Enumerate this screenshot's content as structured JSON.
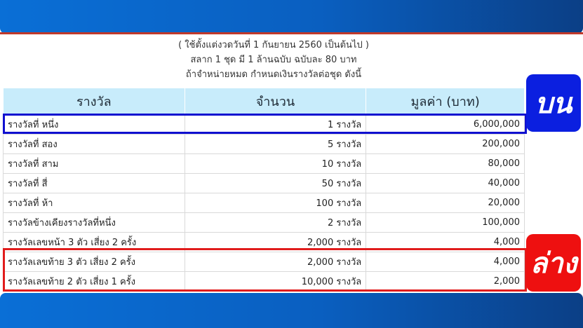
{
  "notes": [
    "( ใช้ตั้งแต่งวดวันที่ 1 กันยายน 2560 เป็นต้นไป )",
    "สลาก 1 ชุด มี 1 ล้านฉบับ ฉบับละ 80 บาท",
    "ถ้าจำหน่ายหมด กำหนดเงินรางวัลต่อชุด ดังนี้"
  ],
  "table": {
    "headers": [
      "รางวัล",
      "จำนวน",
      "มูลค่า (บาท)"
    ],
    "rows": [
      {
        "prize": "รางวัลที่ หนึ่ง",
        "count": "1 รางวัล",
        "value": "6,000,000"
      },
      {
        "prize": "รางวัลที่ สอง",
        "count": "5 รางวัล",
        "value": "200,000"
      },
      {
        "prize": "รางวัลที่ สาม",
        "count": "10 รางวัล",
        "value": "80,000"
      },
      {
        "prize": "รางวัลที่ สี่",
        "count": "50 รางวัล",
        "value": "40,000"
      },
      {
        "prize": "รางวัลที่ ห้า",
        "count": "100 รางวัล",
        "value": "20,000"
      },
      {
        "prize": "รางวัลข้างเคียงรางวัลที่หนึ่ง",
        "count": "2 รางวัล",
        "value": "100,000"
      },
      {
        "prize": "รางวัลเลขหน้า 3 ตัว เสี่ยง 2 ครั้ง",
        "count": "2,000 รางวัล",
        "value": "4,000"
      },
      {
        "prize": "รางวัลเลขท้าย 3 ตัว เสี่ยง 2 ครั้ง",
        "count": "2,000 รางวัล",
        "value": "4,000"
      },
      {
        "prize": "รางวัลเลขท้าย 2 ตัว เสี่ยง 1 ครั้ง",
        "count": "10,000 รางวัล",
        "value": "2,000"
      }
    ]
  },
  "badges": {
    "upper": "บน",
    "lower": "ล่าง"
  },
  "colors": {
    "accent_blue": "#0b1fe0",
    "accent_red": "#ee1010",
    "header_bg": "#c8ecfb",
    "bar_blue": "#0a5fc0"
  }
}
